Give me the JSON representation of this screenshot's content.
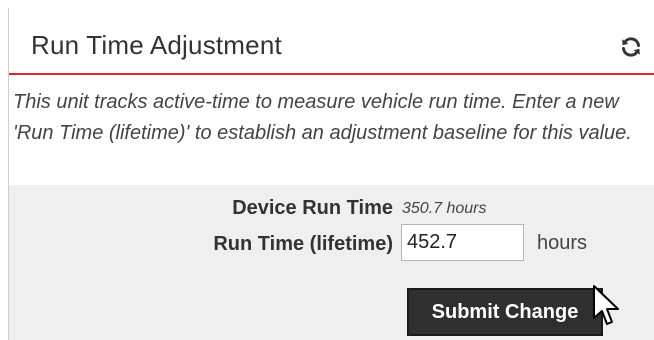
{
  "panel": {
    "title": "Run Time Adjustment",
    "refresh_icon": "refresh-icon",
    "description": "This unit tracks active-time to measure vehicle run time. Enter a new 'Run Time (lifetime)' to establish an adjustment baseline for this value."
  },
  "device_run_time": {
    "label": "Device Run Time",
    "value": "350.7 hours"
  },
  "lifetime": {
    "label": "Run Time (lifetime)",
    "value": "452.7",
    "unit": "hours"
  },
  "submit_label": "Submit Change",
  "cursor_icon": "mouse-pointer-icon",
  "colors": {
    "accent": "#e0262b",
    "button": "#2f2f2f",
    "form_background": "#efefef"
  }
}
